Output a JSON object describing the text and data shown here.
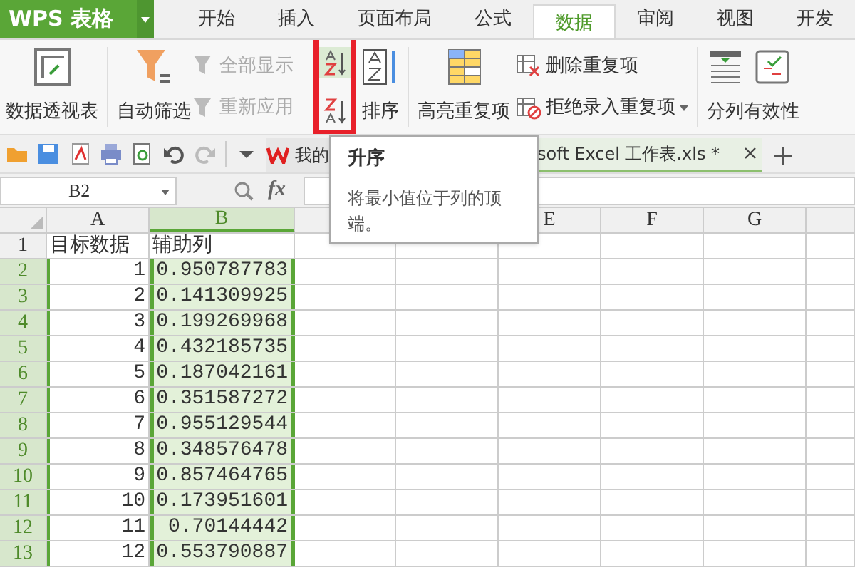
{
  "app_button": {
    "label": "WPS 表格"
  },
  "tabs": [
    {
      "label": "开始",
      "selected": false
    },
    {
      "label": "插入",
      "selected": false
    },
    {
      "label": "页面布局",
      "selected": false
    },
    {
      "label": "公式",
      "selected": false
    },
    {
      "label": "数据",
      "selected": true
    },
    {
      "label": "审阅",
      "selected": false
    },
    {
      "label": "视图",
      "selected": false
    },
    {
      "label": "开发",
      "selected": false
    }
  ],
  "ribbon": {
    "pivot": "数据透视表",
    "autofilter": "自动筛选",
    "show_all": {
      "label": "全部显示",
      "disabled": true
    },
    "reapply": {
      "label": "重新应用",
      "disabled": true
    },
    "sort": "排序",
    "sort_asc": {
      "selected": true
    },
    "highlight_dup": "高亮重复项",
    "remove_dup": "删除重复项",
    "reject_dup": "拒绝录入重复项",
    "split": "分列",
    "validation": "有效性"
  },
  "doc_tabs": [
    {
      "label": "我的",
      "selected": false
    },
    {
      "label": "soft Excel 工作表.xls *",
      "selected": true
    }
  ],
  "name_box": "B2",
  "formula_label": "fx",
  "columns": [
    {
      "label": "A",
      "selected": false
    },
    {
      "label": "B",
      "selected": true
    },
    {
      "label": "E",
      "selected": false
    },
    {
      "label": "F",
      "selected": false
    },
    {
      "label": "G",
      "selected": false
    }
  ],
  "rows": [
    {
      "number": "1",
      "selected": false,
      "kind": "text",
      "cells": [
        "目标数据",
        "辅助列"
      ]
    },
    {
      "number": "2",
      "selected": true,
      "kind": "number",
      "cells": [
        "1",
        "0.950787783"
      ]
    },
    {
      "number": "3",
      "selected": true,
      "kind": "number",
      "cells": [
        "2",
        "0.141309925"
      ]
    },
    {
      "number": "4",
      "selected": true,
      "kind": "number",
      "cells": [
        "3",
        "0.199269968"
      ]
    },
    {
      "number": "5",
      "selected": true,
      "kind": "number",
      "cells": [
        "4",
        "0.432185735"
      ]
    },
    {
      "number": "6",
      "selected": true,
      "kind": "number",
      "cells": [
        "5",
        "0.187042161"
      ]
    },
    {
      "number": "7",
      "selected": true,
      "kind": "number",
      "cells": [
        "6",
        "0.351587272"
      ]
    },
    {
      "number": "8",
      "selected": true,
      "kind": "number",
      "cells": [
        "7",
        "0.955129544"
      ]
    },
    {
      "number": "9",
      "selected": true,
      "kind": "number",
      "cells": [
        "8",
        "0.348576478"
      ]
    },
    {
      "number": "10",
      "selected": true,
      "kind": "number",
      "cells": [
        "9",
        "0.857464765"
      ]
    },
    {
      "number": "11",
      "selected": true,
      "kind": "number",
      "cells": [
        "10",
        "0.173951601"
      ]
    },
    {
      "number": "12",
      "selected": true,
      "kind": "number",
      "cells": [
        "11",
        "0.70144442"
      ]
    },
    {
      "number": "13",
      "selected": true,
      "kind": "number",
      "cells": [
        "12",
        "0.553790887"
      ]
    }
  ],
  "tooltip": {
    "title": "升序",
    "text": "将最小值位于列的顶端。"
  }
}
